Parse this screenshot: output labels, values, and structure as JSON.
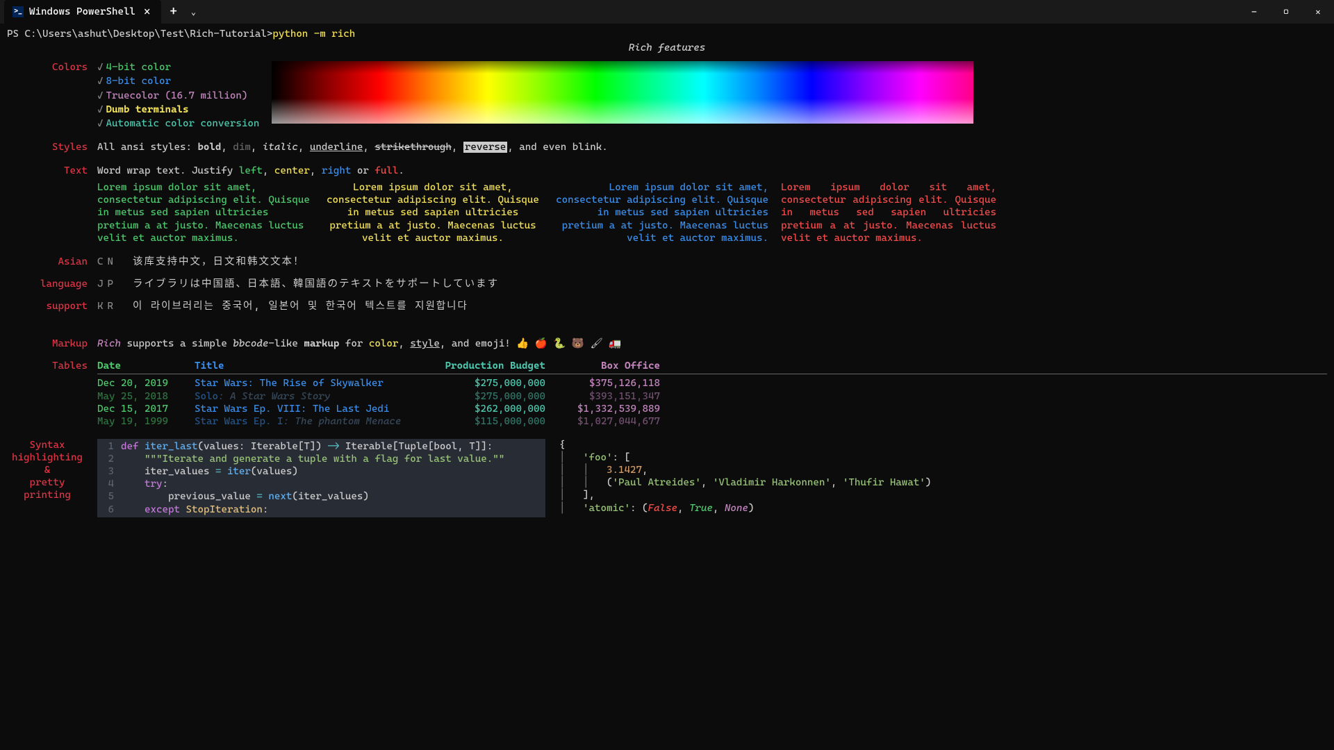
{
  "window": {
    "tab_title": "Windows PowerShell",
    "tab_icon": ">_"
  },
  "prompt": {
    "ps": "PS C:\\Users\\ashut\\Desktop\\Test\\Rich-Tutorial> ",
    "cmd": "python -m rich"
  },
  "title": "Rich features",
  "labels": {
    "colors": "Colors",
    "styles": "Styles",
    "text": "Text",
    "asian": "Asian",
    "language": "language",
    "support": "support",
    "markup": "Markup",
    "tables": "Tables",
    "syntax1": "Syntax",
    "syntax2": "highlighting",
    "syntax3": "&",
    "syntax4": "pretty",
    "syntax5": "printing"
  },
  "colors": {
    "c1": "4-bit color",
    "c2": "8-bit color",
    "c3": "Truecolor (16.7 million)",
    "c4": "Dumb terminals",
    "c5": "Automatic color conversion"
  },
  "styles": {
    "prefix": "All ansi styles: ",
    "bold": "bold",
    "dim": "dim",
    "italic": "italic",
    "underline": "underline",
    "strike": "strikethrough",
    "reverse": "reverse",
    "suffix": ", and even blink."
  },
  "text": {
    "prefix": "Word wrap text. Justify ",
    "left": "left",
    "center": "center",
    "right": "right",
    "or": " or ",
    "full": "full",
    "lorem": "Lorem ipsum dolor sit amet, consectetur adipiscing elit. Quisque in metus sed sapien ultricies pretium a at justo. Maecenas luctus velit et auctor maximus."
  },
  "asian": {
    "cn_code": "CN",
    "cn_text": "该库支持中文，日文和韩文文本！",
    "jp_code": "JP",
    "jp_text": "ライブラリは中国語、日本語、韓国語のテキストをサポートしています",
    "kr_code": "KR",
    "kr_text": "이 라이브러리는 중국어, 일본어 및 한국어 텍스트를 지원합니다"
  },
  "markup": {
    "rich": "Rich",
    "p1": " supports a simple ",
    "bbcode": "bbcode",
    "p2": "-like ",
    "markup": "markup",
    "p3": " for ",
    "color": "color",
    "p4": ", ",
    "style": "style",
    "p5": ", and emoji! 👍 🍎 🐍 🐻 🖌 🚛"
  },
  "table": {
    "headers": {
      "date": "Date",
      "title": "Title",
      "budget": "Production Budget",
      "box": "Box Office"
    },
    "rows": [
      {
        "date": "Dec 20, 2019",
        "title": "Star Wars: The Rise of Skywalker",
        "sub": "",
        "budget": "$275,000,000",
        "box": "$375,126,118",
        "dim": false
      },
      {
        "date": "May 25, 2018",
        "title": "Solo",
        "sub": ": A Star Wars Story",
        "budget": "$275,000,000",
        "box": "$393,151,347",
        "dim": true
      },
      {
        "date": "Dec 15, 2017",
        "title": "Star Wars Ep. VIII: The Last Jedi",
        "sub": "",
        "budget": "$262,000,000",
        "box": "$1,332,539,889",
        "dim": false
      },
      {
        "date": "May 19, 1999",
        "title": "Star Wars Ep. I",
        "sub": ": The phantom Menace",
        "budget": "$115,000,000",
        "box": "$1,027,044,677",
        "dim": true
      }
    ]
  },
  "code": {
    "lines": [
      "1",
      "2",
      "3",
      "4",
      "5",
      "6"
    ],
    "l1a": "def ",
    "l1b": "iter_last",
    "l1c": "(values: Iterable[T]) ",
    "l1d": "-> ",
    "l1e": "Iterable[Tuple[bool, T]]:",
    "l2": "\"\"\"Iterate and generate a tuple with a flag for last value.\"\"",
    "l3a": "iter_values ",
    "l3b": "= ",
    "l3c": "iter",
    "l3d": "(values)",
    "l4": "try",
    "l5a": "previous_value ",
    "l5b": "= ",
    "l5c": "next",
    "l5d": "(iter_values)",
    "l6a": "except ",
    "l6b": "StopIteration",
    "json_l1": "{",
    "json_l2a": "'foo'",
    "json_l2b": ": [",
    "json_l3": "3.1427",
    "json_l4a": "'Paul Atreides'",
    "json_l4b": "'Vladimir Harkonnen'",
    "json_l4c": "'Thufir Hawat'",
    "json_l5": "],",
    "json_l6a": "'atomic'",
    "json_l6b": ": (",
    "json_l6c": "False",
    "json_l6d": "True",
    "json_l6e": "None",
    "json_l6f": ")"
  }
}
